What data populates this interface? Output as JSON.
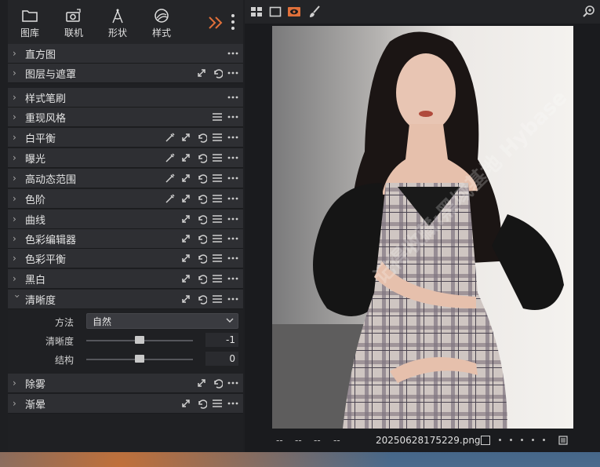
{
  "tool_tabs": [
    {
      "label": "图库",
      "icon": "folder-icon"
    },
    {
      "label": "联机",
      "icon": "camera-tether-icon"
    },
    {
      "label": "形状",
      "icon": "compass-icon"
    },
    {
      "label": "样式",
      "icon": "style-icon"
    }
  ],
  "tools": [
    {
      "name": "直方图",
      "expanded": false
    },
    {
      "name": "图层与遮罩",
      "expanded": false
    },
    {
      "name": "样式笔刷",
      "expanded": false
    },
    {
      "name": "重现风格",
      "expanded": false
    },
    {
      "name": "白平衡",
      "expanded": false
    },
    {
      "name": "曝光",
      "expanded": false
    },
    {
      "name": "高动态范围",
      "expanded": false
    },
    {
      "name": "色阶",
      "expanded": false
    },
    {
      "name": "曲线",
      "expanded": false
    },
    {
      "name": "色彩编辑器",
      "expanded": false
    },
    {
      "name": "色彩平衡",
      "expanded": false
    },
    {
      "name": "黑白",
      "expanded": false
    },
    {
      "name": "清晰度",
      "expanded": true
    },
    {
      "name": "除雾",
      "expanded": false
    },
    {
      "name": "渐晕",
      "expanded": false
    }
  ],
  "clarity": {
    "method_label": "方法",
    "method_value": "自然",
    "clarity_label": "清晰度",
    "clarity_value": "-1",
    "clarity_position": 0.5,
    "structure_label": "结构",
    "structure_value": "0",
    "structure_position": 0.5
  },
  "status": {
    "dashes": [
      "--",
      "--",
      "--",
      "--"
    ],
    "filename": "20250628175229.png"
  },
  "watermark": {
    "text": "记得收藏:黑域基地 Hybase"
  },
  "colors": {
    "accent": "#e0703a",
    "panel": "#2e2f33"
  }
}
